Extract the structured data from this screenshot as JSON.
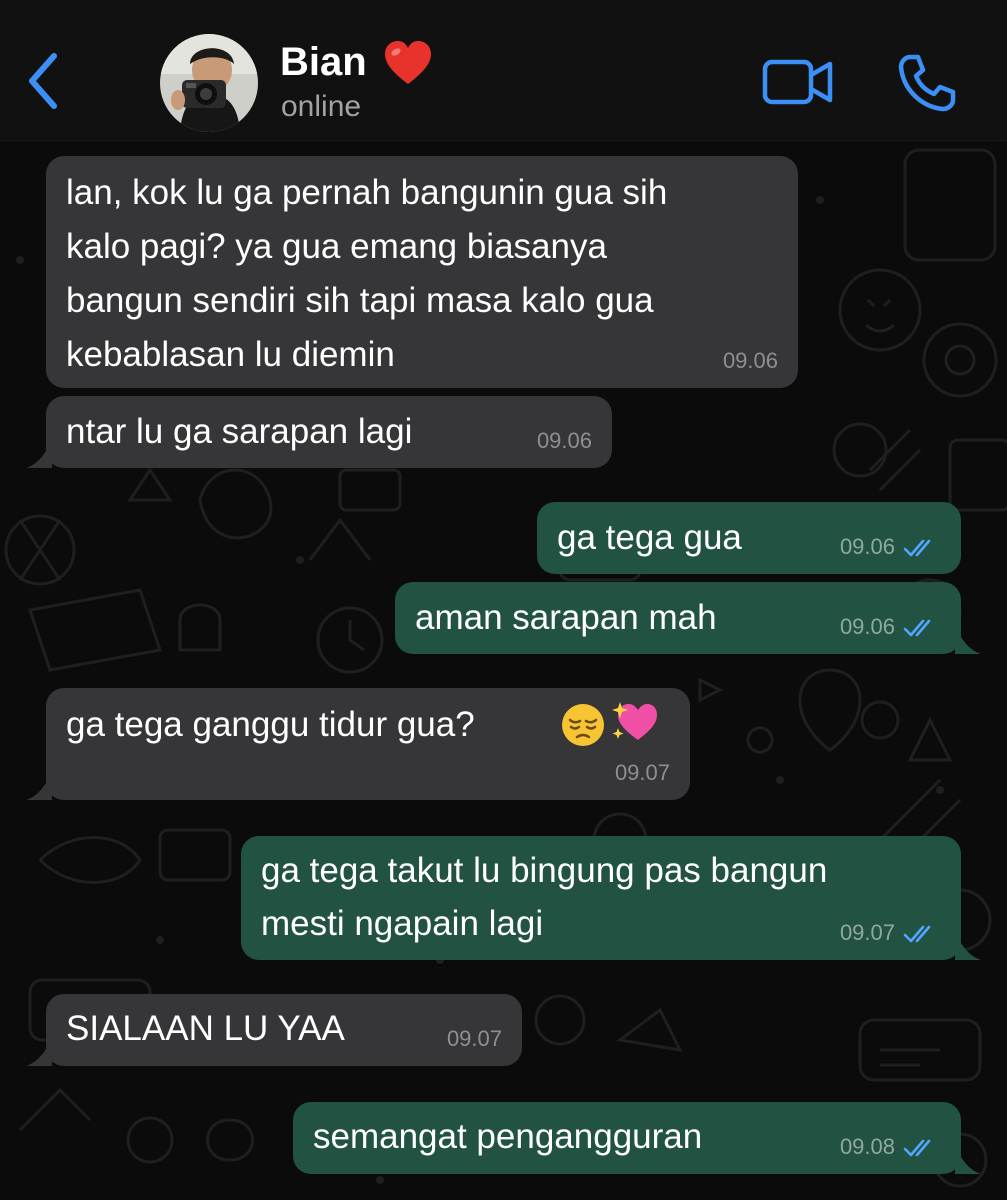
{
  "header": {
    "contact_name": "Bian",
    "status": "online"
  },
  "colors": {
    "accent": "#3b8ff5",
    "incoming_bubble": "#363638",
    "outgoing_bubble": "#225242",
    "read_ticks": "#53a6ff"
  },
  "icons": {
    "back": "chevron-left-icon",
    "name_emoji": "red-heart-icon",
    "video": "video-camera-icon",
    "call": "phone-icon",
    "read_receipt": "double-check-icon"
  },
  "messages": [
    {
      "direction": "incoming",
      "lines": [
        "lan, kok lu ga pernah bangunin gua sih",
        "kalo pagi? ya gua emang biasanya",
        "bangun sendiri sih tapi masa kalo gua",
        "kebablasan lu diemin"
      ],
      "time": "09.06"
    },
    {
      "direction": "incoming",
      "lines": [
        "ntar lu ga sarapan lagi"
      ],
      "time": "09.06"
    },
    {
      "direction": "outgoing",
      "lines": [
        "ga tega gua"
      ],
      "time": "09.06",
      "read": true
    },
    {
      "direction": "outgoing",
      "lines": [
        "aman sarapan mah"
      ],
      "time": "09.06",
      "read": true
    },
    {
      "direction": "incoming",
      "lines": [
        "ga tega ganggu tidur gua?"
      ],
      "emojis": [
        "pensive-face-icon",
        "sparkling-heart-icon"
      ],
      "time": "09.07"
    },
    {
      "direction": "outgoing",
      "lines": [
        "ga tega takut lu bingung pas bangun",
        "mesti ngapain lagi"
      ],
      "time": "09.07",
      "read": true
    },
    {
      "direction": "incoming",
      "lines": [
        "SIALAAN LU YAA"
      ],
      "time": "09.07"
    },
    {
      "direction": "outgoing",
      "lines": [
        "semangat pengangguran"
      ],
      "time": "09.08",
      "read": true
    }
  ]
}
